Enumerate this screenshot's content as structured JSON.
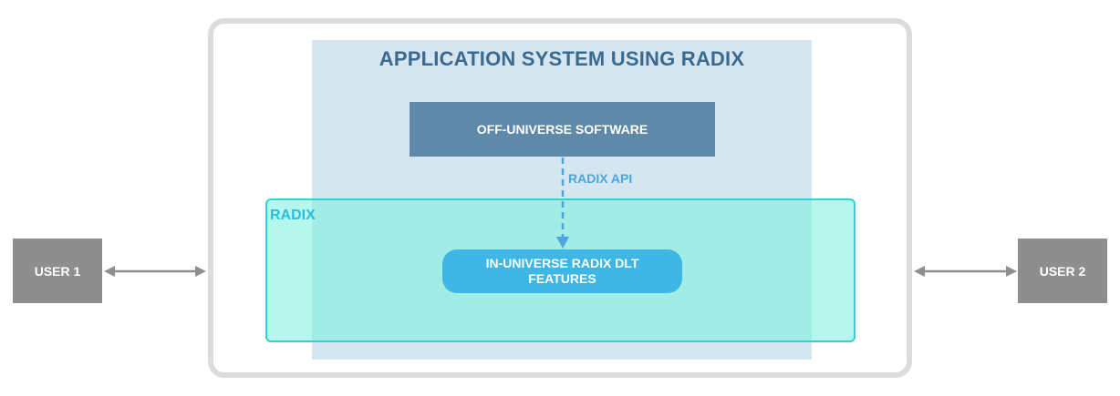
{
  "diagram": {
    "app_title": "APPLICATION SYSTEM USING RADIX",
    "off_universe": "OFF-UNIVERSE SOFTWARE",
    "api_label": "RADIX API",
    "radix_label": "RADIX",
    "in_universe_line1": "IN-UNIVERSE RADIX DLT",
    "in_universe_line2": "FEATURES",
    "user1": "USER 1",
    "user2": "USER 2"
  },
  "colors": {
    "app_panel": "#d5e6f1",
    "off_box": "#5f89a8",
    "radix_panel": "#78f0dc",
    "in_box": "#3eb6e6",
    "user_box": "#8e8e8e",
    "arrow": "#8e8e8e",
    "api_arrow": "#4aa6dc"
  }
}
